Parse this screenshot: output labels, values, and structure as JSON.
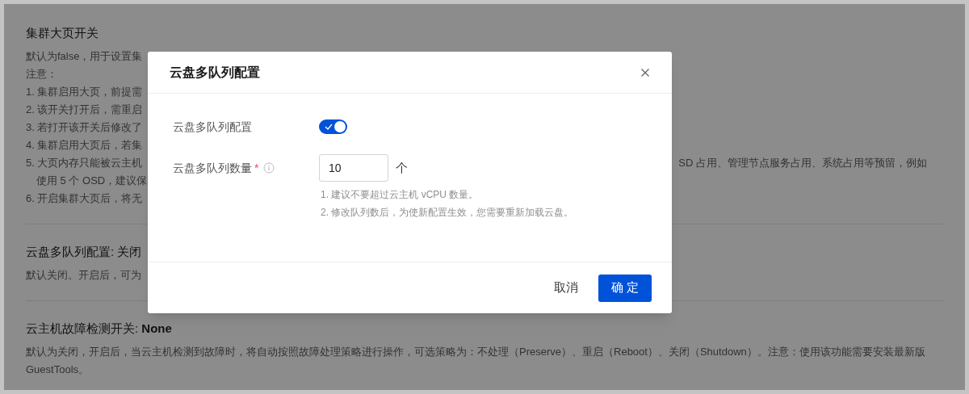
{
  "background": {
    "sections": [
      {
        "title": "集群大页开关",
        "lines": [
          {
            "left": "默认为false，用于设置集"
          },
          {
            "left": "注意："
          },
          {
            "left": "1. 集群启用大页，前提需"
          },
          {
            "left": "2. 该开关打开后，需重启"
          },
          {
            "left": "3. 若打开该开关后修改了"
          },
          {
            "left": "4. 集群启用大页后，若集"
          },
          {
            "left": "5. 大页内存只能被云主机",
            "right": "SD 占用、管理节点服务占用、系统占用等预留，例如"
          },
          {
            "left": "使用 5 个 OSD，建议保",
            "indent": true
          },
          {
            "left": "6. 开启集群大页后，将无"
          }
        ]
      },
      {
        "title": "云盘多队列配置: 关闭",
        "lines": [
          {
            "left": "默认关闭。开启后，可为"
          }
        ]
      },
      {
        "title": "云主机故障检测开关: **None**",
        "lines": [
          {
            "left": "默认为关闭，开启后，当云主机检测到故障时，将自动按照故障处理策略进行操作，可选策略为：不处理（Preserve）、重启（Reboot）、关闭（Shutdown）。注意：使用该功能需要安装最新版"
          },
          {
            "left": "GuestTools。"
          }
        ]
      }
    ]
  },
  "dialog": {
    "title": "云盘多队列配置",
    "fields": [
      {
        "kind": "toggle",
        "label": "云盘多队列配置",
        "on": true
      },
      {
        "kind": "number",
        "label": "云盘多队列数量",
        "required_mark": "*",
        "value": "10",
        "unit": "个",
        "hints": [
          "1. 建议不要超过云主机 vCPU 数量。",
          "2. 修改队列数后，为使新配置生效，您需要重新加载云盘。"
        ]
      }
    ],
    "buttons": [
      {
        "label": "取消",
        "kind": "secondary"
      },
      {
        "label": "确 定",
        "kind": "primary"
      }
    ]
  }
}
